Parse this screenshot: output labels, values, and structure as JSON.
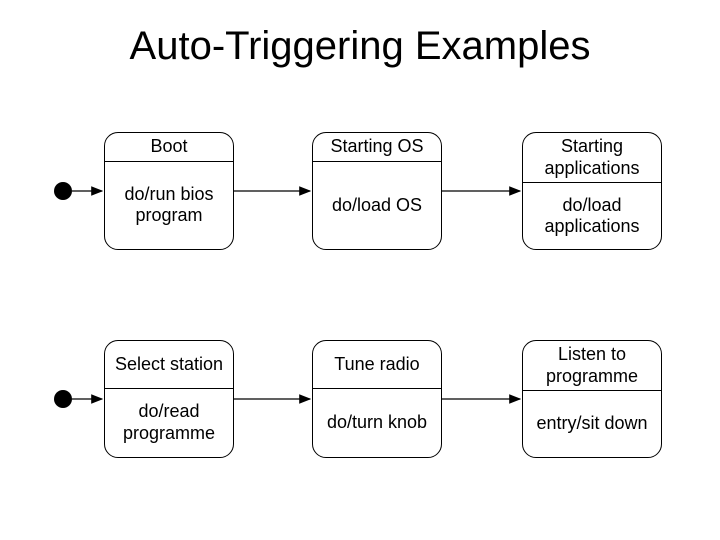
{
  "title": "Auto-Triggering Examples",
  "row1": {
    "s1": {
      "name": "Boot",
      "action": "do/run bios program"
    },
    "s2": {
      "name": "Starting OS",
      "action": "do/load OS"
    },
    "s3": {
      "name": "Starting applications",
      "action": "do/load applications"
    }
  },
  "row2": {
    "s1": {
      "name": "Select station",
      "action": "do/read programme"
    },
    "s2": {
      "name": "Tune radio",
      "action": "do/turn knob"
    },
    "s3": {
      "name": "Listen to programme",
      "action": "entry/sit down"
    }
  }
}
